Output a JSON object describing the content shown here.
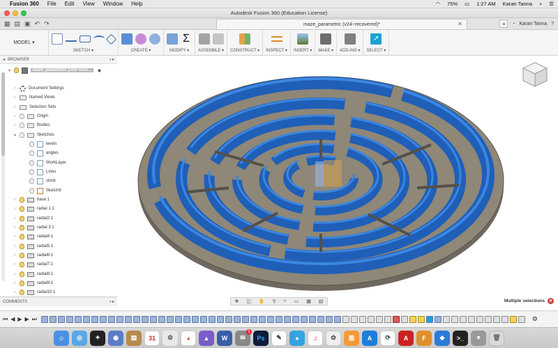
{
  "menubar": {
    "app_name": "Fusion 360",
    "items": [
      "File",
      "Edit",
      "View",
      "Window",
      "Help"
    ],
    "battery": "75%",
    "time": "1:27 AM",
    "user": "Karan Tanna"
  },
  "window": {
    "title": "Autodesk Fusion 360 (Education License)"
  },
  "tabbar": {
    "doc_tab": "maze_parametric (v24~recovered)*",
    "user": "Karan Tanna"
  },
  "toolbar": {
    "workspace": "MODEL",
    "groups": [
      {
        "label": "SKETCH ▾"
      },
      {
        "label": "CREATE ▾"
      },
      {
        "label": "MODIFY ▾"
      },
      {
        "label": "ASSEMBLE ▾"
      },
      {
        "label": "CONSTRUCT ▾"
      },
      {
        "label": "INSPECT ▾"
      },
      {
        "label": "INSERT ▾"
      },
      {
        "label": "MAKE ▾"
      },
      {
        "label": "ADD-INS ▾"
      },
      {
        "label": "SELECT ▾"
      }
    ]
  },
  "browser": {
    "header": "BROWSER",
    "root": "maze_parametric (v24~reco...",
    "items": [
      {
        "label": "Document Settings"
      },
      {
        "label": "Named Views"
      },
      {
        "label": "Selection Sets"
      },
      {
        "label": "Origin"
      },
      {
        "label": "Bodies"
      },
      {
        "label": "Sketches"
      },
      {
        "label": "levels"
      },
      {
        "label": "angles"
      },
      {
        "label": "WorkLayer"
      },
      {
        "label": "Lines"
      },
      {
        "label": "stock"
      },
      {
        "label": "Sketch8"
      },
      {
        "label": "base:1"
      },
      {
        "label": "radial 1:1"
      },
      {
        "label": "radial2:1"
      },
      {
        "label": "radial 3:1"
      },
      {
        "label": "radial4:1"
      },
      {
        "label": "radial5:1"
      },
      {
        "label": "radial6:1"
      },
      {
        "label": "radial7:1"
      },
      {
        "label": "radial8:1"
      },
      {
        "label": "radial9:1"
      },
      {
        "label": "radial10:1"
      }
    ]
  },
  "comments": {
    "label": "COMMENTS"
  },
  "status": {
    "selection": "Multiple selections"
  },
  "dock": {
    "calendar_day": "31",
    "badge_count": "1"
  },
  "colors": {
    "wall_blue": "#2f76d2",
    "base_gray": "#8c8579",
    "accent_select": "#1da1d6"
  }
}
